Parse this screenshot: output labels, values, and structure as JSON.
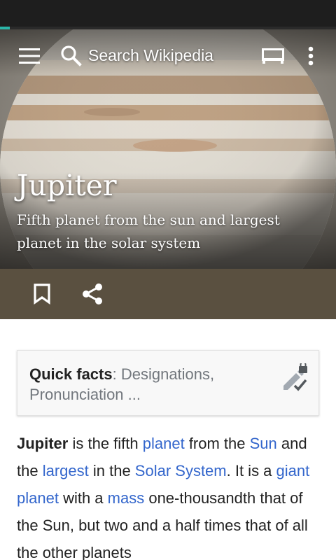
{
  "progress": {
    "percent": 3
  },
  "toolbar": {
    "search_placeholder": "Search Wikipedia",
    "menu_icon": "hamburger-menu-icon",
    "search_icon": "search-icon",
    "reader_icon": "reading-lists-icon",
    "more_icon": "more-vert-icon"
  },
  "article": {
    "title": "Jupiter",
    "description": "Fifth planet from the sun and largest planet in the solar system"
  },
  "actions": {
    "bookmark_icon": "bookmark-icon",
    "share_icon": "share-icon"
  },
  "quick_facts": {
    "label": "Quick facts",
    "separator": ": ",
    "summary": "Designations, Pronunciation ...",
    "icon": "edit-locked-icon"
  },
  "body": {
    "t1": "Jupiter",
    "t2": " is the fifth ",
    "l1": "planet",
    "t3": " from the ",
    "l2": "Sun",
    "t4": " and the ",
    "l3": "largest",
    "t5": " in the ",
    "l4": "Solar System",
    "t6": ". It is a ",
    "l5": "giant planet",
    "t7": " with a ",
    "l6": "mass",
    "t8": " one-thousandth that of the Sun, but two and a half times that of all the other planets"
  },
  "colors": {
    "link": "#3366cc",
    "action_bar": "#5a5040",
    "progress": "#2bb5a8",
    "status_bar": "#1e1e1e"
  }
}
